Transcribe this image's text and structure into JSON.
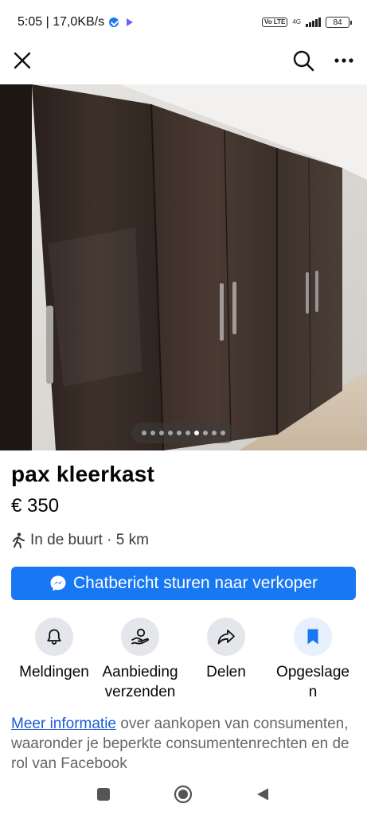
{
  "status": {
    "time_speed": "5:05 | 17,0KB/s",
    "volte": "Vo LTE",
    "network": "4G",
    "battery": "84"
  },
  "icons": {
    "close": "close-icon",
    "search": "search-icon",
    "more": "more-icon",
    "walk": "walking-person-icon",
    "messenger": "messenger-icon",
    "bell": "bell-icon",
    "offer": "offer-hand-icon",
    "share": "share-arrow-icon",
    "save": "bookmark-icon"
  },
  "photo": {
    "dot_count": 10,
    "active_dot": 6
  },
  "listing": {
    "title": "pax kleerkast",
    "price": "€ 350",
    "location": "In de buurt · 5 km"
  },
  "cta": {
    "label": "Chatbericht sturen naar verkoper"
  },
  "actions": [
    {
      "label": "Meldingen"
    },
    {
      "label_line1": "Aanbieding",
      "label_line2": "verzenden"
    },
    {
      "label": "Delen"
    },
    {
      "label_line1": "Opgeslage",
      "label_line2": "n"
    }
  ],
  "info": {
    "link": "Meer informatie",
    "text": " over aankopen van consumenten, waaronder je beperkte consumentenrechten en de rol van Facebook"
  },
  "colors": {
    "accent": "#1877f2",
    "link": "#1d5bd6"
  }
}
